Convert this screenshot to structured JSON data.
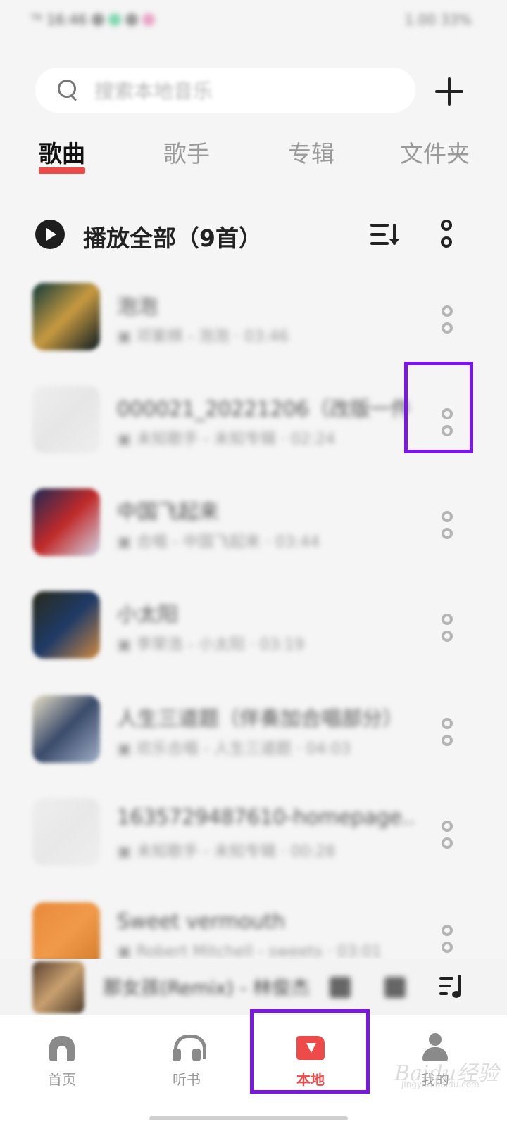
{
  "status_bar": {
    "left_text": "ᵀ⁶ 16:46",
    "right_text": "1.00 33%"
  },
  "search": {
    "placeholder": "搜索本地音乐"
  },
  "tabs": [
    {
      "label": "歌曲",
      "active": true
    },
    {
      "label": "歌手",
      "active": false
    },
    {
      "label": "专辑",
      "active": false
    },
    {
      "label": "文件夹",
      "active": false
    }
  ],
  "play_all": {
    "label": "播放全部（9首）"
  },
  "songs": [
    {
      "title": "泡泡",
      "subtitle": "▣ 邓紫棋 - 泡泡 · 03:46",
      "cover_colors": [
        "#0e3a3a",
        "#c89a40",
        "#0a1a22"
      ]
    },
    {
      "title": "000021_20221206（改版一件...",
      "subtitle": "▣ 未知歌手 - 未知专辑 · 02:24",
      "cover_colors": [
        "#eeeeee",
        "#e6e6e6",
        "#eeeeee"
      ]
    },
    {
      "title": "中国飞起来",
      "subtitle": "▣ 合唱 - 中国飞起来 · 03:44",
      "cover_colors": [
        "#1a2a55",
        "#c02a2a",
        "#d0d8e8"
      ]
    },
    {
      "title": "小太阳",
      "subtitle": "▣ 李荣浩 - 小太阳 · 03:19",
      "cover_colors": [
        "#2a2a1a",
        "#1e3a66",
        "#d08a40"
      ]
    },
    {
      "title": "人生三道题（伴奏加合唱部分）",
      "subtitle": "▣ 欢乐合唱 - 人生三道题 · 04:03",
      "cover_colors": [
        "#e8e0c8",
        "#3a4a6a",
        "#a0b0c8"
      ]
    },
    {
      "title": "1635729487610-homepage...",
      "subtitle": "▣ 未知歌手 - 未知专辑 · 00:28",
      "cover_colors": [
        "#eeeeee",
        "#e8e8e8",
        "#eeeeee"
      ]
    },
    {
      "title": "Sweet vermouth",
      "subtitle": "▣ Robert Mitchell - sweets · 03:01",
      "cover_colors": [
        "#e88a3a",
        "#f09a4a",
        "#d07a2a"
      ]
    }
  ],
  "mini_player": {
    "title": "那女孩(Remix) - 林俊杰"
  },
  "bottom_nav": [
    {
      "label": "首页",
      "icon": "home-icon",
      "active": false
    },
    {
      "label": "听书",
      "icon": "headphones-icon",
      "active": false
    },
    {
      "label": "本地",
      "icon": "folder-download-icon",
      "active": true
    },
    {
      "label": "我的",
      "icon": "person-icon",
      "active": false
    }
  ],
  "watermark": {
    "logo_text": "Baidu经验",
    "url_text": "jingyan.baidu.com"
  },
  "colors": {
    "accent": "#ee4a4a",
    "highlight": "#7a16e8",
    "background": "#f5f5f5"
  }
}
